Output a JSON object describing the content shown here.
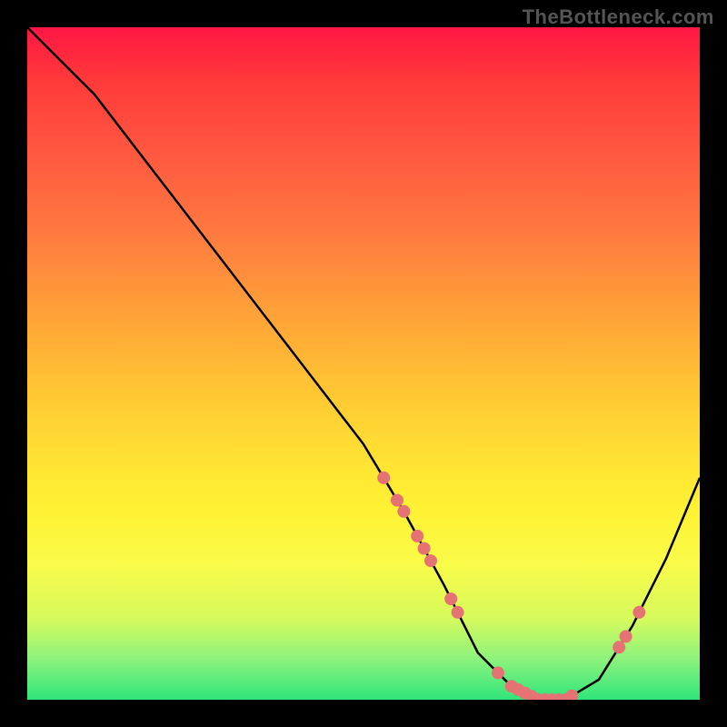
{
  "watermark": "TheBottleneck.com",
  "chart_data": {
    "type": "line",
    "title": "",
    "xlabel": "",
    "ylabel": "",
    "ylim": [
      0,
      100
    ],
    "x": [
      0,
      3,
      10,
      20,
      30,
      40,
      50,
      56,
      62,
      67,
      72,
      76,
      80,
      85,
      90,
      95,
      100
    ],
    "values": [
      100,
      97,
      90,
      77,
      64,
      51,
      38,
      28,
      17,
      7,
      2,
      0,
      0,
      3,
      11,
      21,
      33
    ],
    "valley_range_x": [
      72,
      80
    ],
    "marker_clusters_x": [
      53,
      55,
      56,
      58,
      59,
      60,
      63,
      64,
      70,
      72,
      73,
      74,
      75,
      76,
      77,
      78,
      79,
      80,
      81,
      88,
      89,
      91
    ]
  },
  "colors": {
    "curve": "#000000",
    "marker": "#e57373",
    "frame_bg": "#000000"
  }
}
